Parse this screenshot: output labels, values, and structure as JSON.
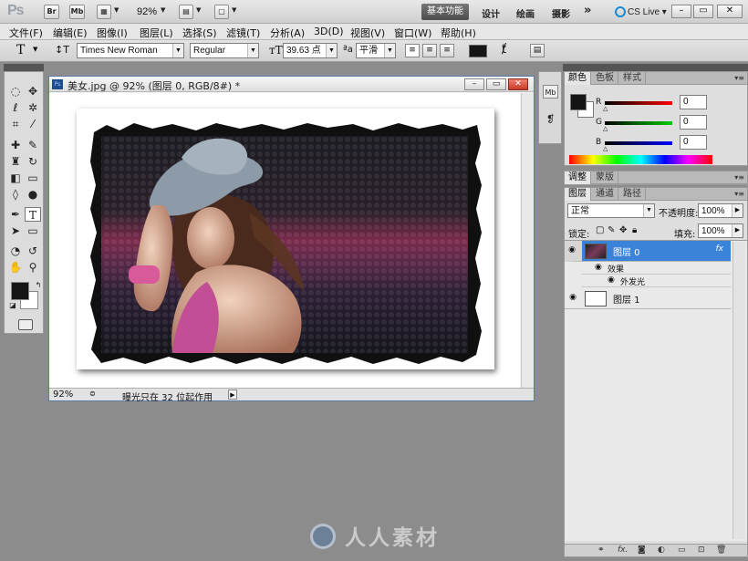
{
  "app": {
    "logo": "Ps",
    "zoom": "92%",
    "workspace_active": "基本功能",
    "workspaces": [
      "设计",
      "绘画",
      "摄影"
    ],
    "more": "»",
    "cslive": "CS Live",
    "window_buttons": [
      "–",
      "▭",
      "✕"
    ]
  },
  "menu": [
    "文件(F)",
    "编辑(E)",
    "图像(I)",
    "图层(L)",
    "选择(S)",
    "滤镜(T)",
    "分析(A)",
    "3D(D)",
    "视图(V)",
    "窗口(W)",
    "帮助(H)"
  ],
  "options": {
    "tool_icon": "T",
    "font_family": "Times New Roman",
    "font_style": "Regular",
    "font_size": "39.63 点",
    "aa_label": "ªa",
    "antialias": "平滑"
  },
  "document": {
    "title": "美女.jpg @ 92% (图层 0, RGB/8#) *",
    "status_zoom": "92%",
    "status_text": "曝光只在 32 位起作用"
  },
  "color_panel": {
    "tabs": [
      "颜色",
      "色板",
      "样式"
    ],
    "r_label": "R",
    "g_label": "G",
    "b_label": "B",
    "r": "0",
    "g": "0",
    "b": "0"
  },
  "adjust_panel": {
    "tabs": [
      "调整",
      "蒙版"
    ]
  },
  "layers_panel": {
    "tabs": [
      "图层",
      "通道",
      "路径"
    ],
    "blend_mode": "正常",
    "opacity_label": "不透明度:",
    "opacity": "100%",
    "lock_label": "锁定:",
    "fill_label": "填充:",
    "fill": "100%",
    "layers": [
      {
        "name": "图层 0",
        "fx": "fx"
      },
      {
        "name": "图层 1"
      }
    ],
    "effects_label": "效果",
    "effect_item": "外发光"
  },
  "watermark": "人人素材",
  "colors": {
    "fg": "#141414",
    "bg": "#ffffff",
    "layer_selected": "#3b82d9"
  }
}
